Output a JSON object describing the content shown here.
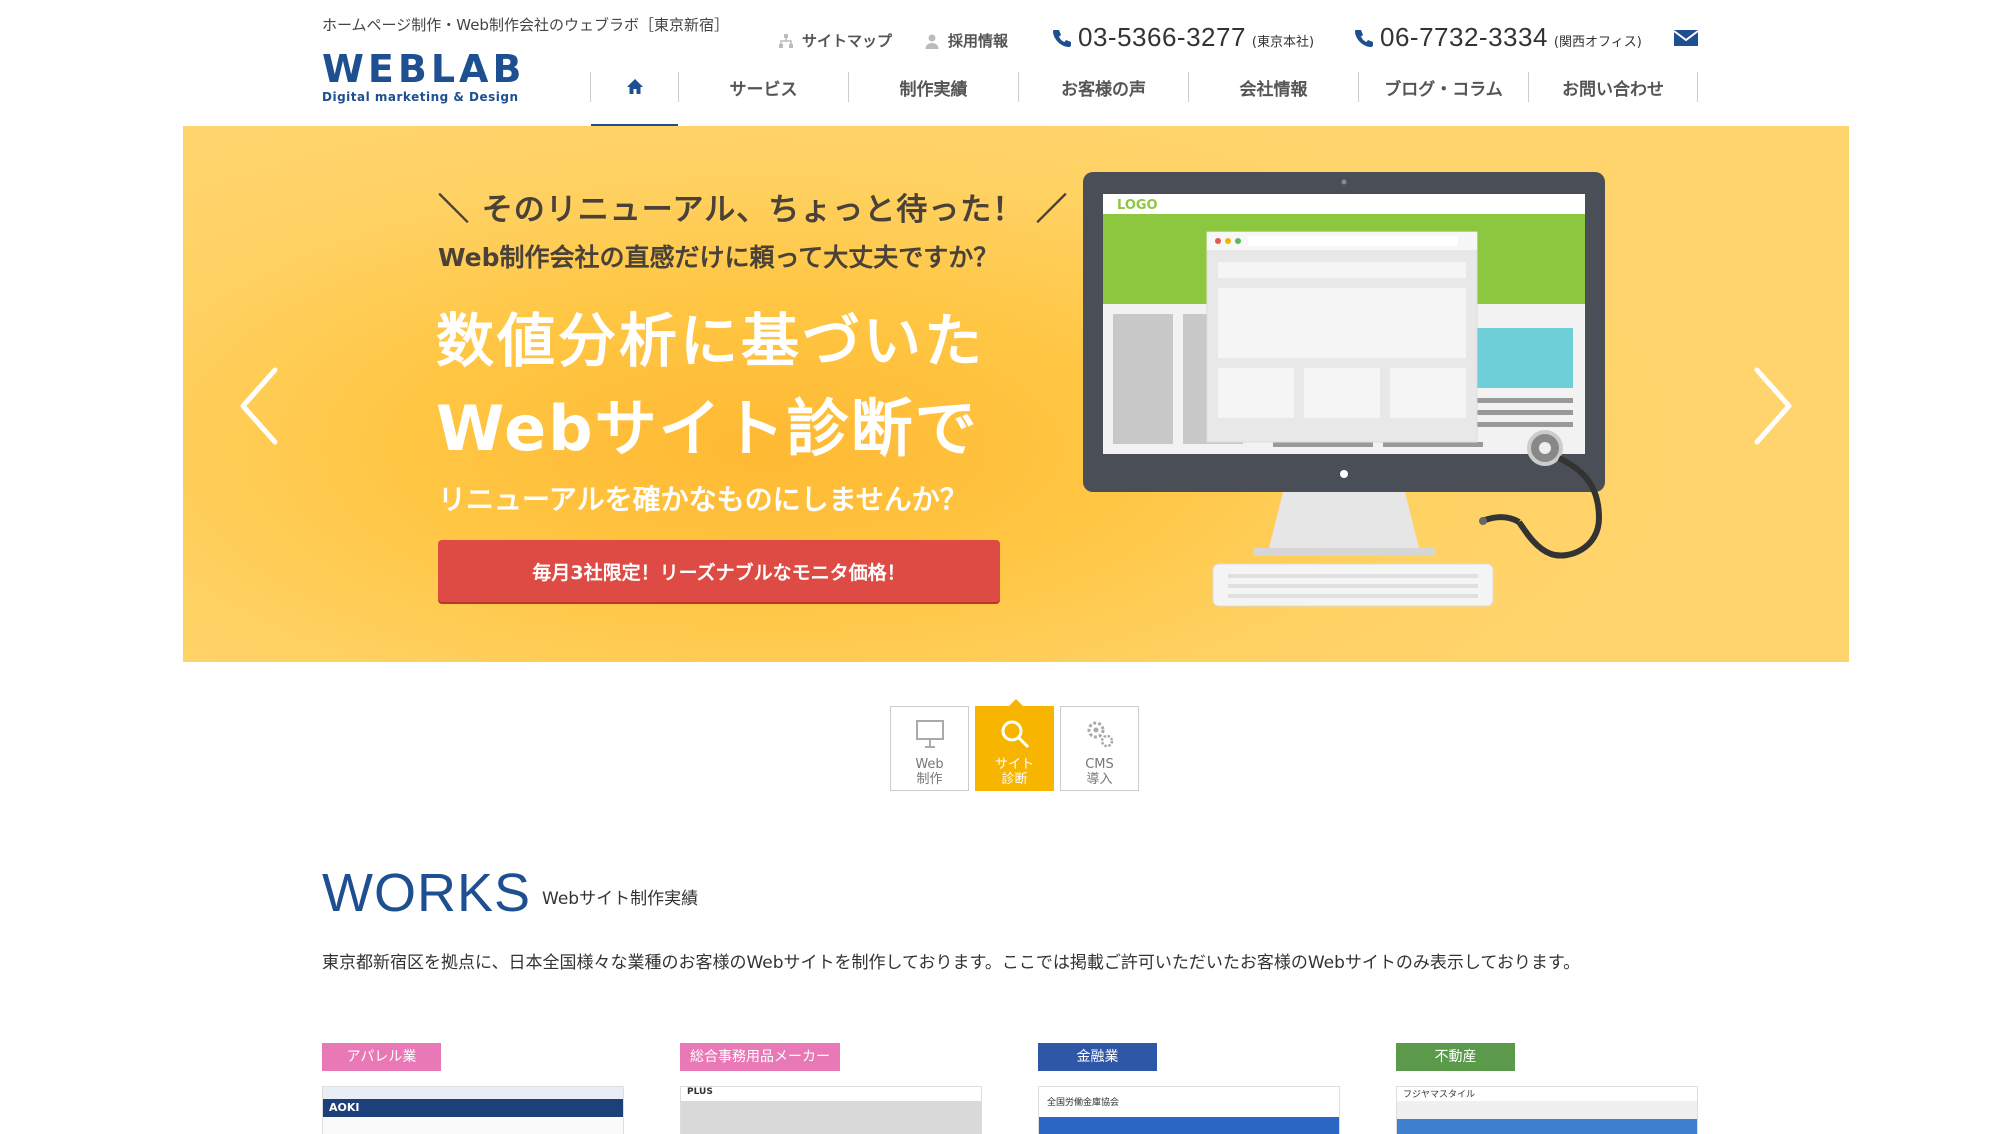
{
  "header": {
    "tagline": "ホームページ制作・Web制作会社のウェブラボ［東京新宿］",
    "logo_main": "WEBLAB",
    "logo_sub": "Digital marketing & Design",
    "sitemap_label": "サイトマップ",
    "recruit_label": "採用情報",
    "phones": [
      {
        "number": "03-5366-3277",
        "location": "(東京本社)"
      },
      {
        "number": "06-7732-3334",
        "location": "(関西オフィス)"
      }
    ]
  },
  "nav": {
    "items": [
      "サービス",
      "制作実績",
      "お客様の声",
      "会社情報",
      "ブログ・コラム",
      "お問い合わせ"
    ]
  },
  "hero": {
    "catch": "＼ そのリニューアル、ちょっと待った！ ／",
    "question": "Web制作会社の直感だけに頼って大丈夫ですか？",
    "main_line1": "数値分析に基づいた",
    "main_line2": "Webサイト診断で",
    "sub": "リニューアルを確かなものにしませんか？",
    "button": "毎月3社限定！リーズナブルなモニタ価格！",
    "screen_logo": "LOGO"
  },
  "tabs": [
    {
      "label": "Web\n制作",
      "icon": "monitor-icon",
      "active": false
    },
    {
      "label": "サイト\n診断",
      "icon": "magnifier-icon",
      "active": true
    },
    {
      "label": "CMS\n導入",
      "icon": "gears-icon",
      "active": false
    }
  ],
  "works": {
    "title": "WORKS",
    "subtitle": "Webサイト制作実績",
    "description": "東京都新宿区を拠点に、日本全国様々な業種のお客様のWebサイトを制作しております。ここでは掲載ご許可いただいたお客様のWebサイトのみ表示しております。",
    "categories": [
      {
        "label": "アパレル業",
        "color": "#e879b6"
      },
      {
        "label": "総合事務用品メーカー",
        "color": "#e879b6"
      },
      {
        "label": "金融業",
        "color": "#2f57a8"
      },
      {
        "label": "不動産",
        "color": "#5a9a4a"
      }
    ],
    "thumb_texts": [
      "AOKI",
      "PLUS",
      "全国労働金庫協会",
      "フジヤマスタイル"
    ]
  },
  "colors": {
    "brand": "#1d4f91",
    "hero_bg": "#ffc644",
    "cta": "#de4a44",
    "tab_active": "#f7b500"
  }
}
